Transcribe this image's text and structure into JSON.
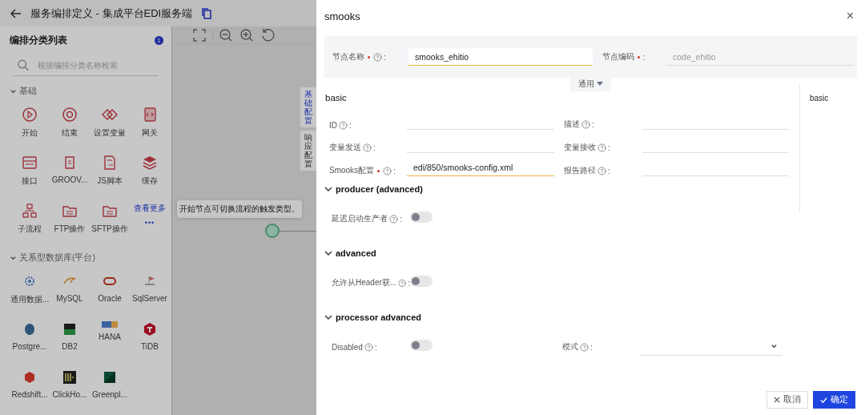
{
  "page": {
    "title": "服务编排定义 - 集成平台EDI服务端"
  },
  "palette": {
    "title": "编排分类列表",
    "badge": "1",
    "search_placeholder": "根据编排分类名称检索",
    "groups": [
      {
        "name": "基础",
        "expanded": true,
        "items": [
          {
            "label": "开始"
          },
          {
            "label": "结束"
          },
          {
            "label": "设置变量"
          },
          {
            "label": "网关"
          },
          {
            "label": "接口"
          },
          {
            "label": "GROOV..."
          },
          {
            "label": "JS脚本"
          },
          {
            "label": "缓存"
          },
          {
            "label": "子流程"
          },
          {
            "label": "FTP操作"
          },
          {
            "label": "SFTP操作"
          }
        ],
        "more": {
          "label": "查看更多",
          "dots": "•••"
        }
      },
      {
        "name": "关系型数据库(平台)",
        "expanded": true,
        "items": [
          {
            "label": "通用数据..."
          },
          {
            "label": "MySQL"
          },
          {
            "label": "Oracle"
          },
          {
            "label": "SqlServer"
          },
          {
            "label": "Postgre..."
          },
          {
            "label": "DB2"
          },
          {
            "label": "HANA"
          },
          {
            "label": "TiDB"
          },
          {
            "label": "Redshift..."
          },
          {
            "label": "ClickHo..."
          },
          {
            "label": "Greenpl..."
          }
        ]
      }
    ]
  },
  "canvas": {
    "side_tabs": [
      {
        "label": "基础配置",
        "selected": true
      },
      {
        "label": "响应配置",
        "selected": false
      }
    ],
    "tooltip": "开始节点可切换流程的触发类型。"
  },
  "drawer": {
    "title": "smooks",
    "close": "×",
    "header_fields": [
      {
        "label": "节点名称",
        "colon": ":",
        "required": true,
        "help": true,
        "value": "smooks_ehitio",
        "focused": true
      },
      {
        "label": "节点编码",
        "colon": ":",
        "required": true,
        "help": false,
        "placeholder": "code_ehitio",
        "focused": false
      }
    ],
    "collapse_toggle": "通用",
    "section_title": "basic",
    "nav": [
      {
        "label": "basic"
      }
    ],
    "basic_fields": [
      {
        "label": "ID",
        "colon": ":",
        "required": false,
        "help": true,
        "focused": false
      },
      {
        "label": "描述",
        "colon": ":",
        "required": false,
        "help": true,
        "focused": false
      },
      {
        "label": "变量发送",
        "colon": ":",
        "required": false,
        "help": true,
        "focused": false
      },
      {
        "label": "变量接收",
        "colon": ":",
        "required": false,
        "help": true,
        "focused": false
      },
      {
        "label": "Smooks配置",
        "colon": ":",
        "required": true,
        "help": true,
        "value": "edi/850/smooks-config.xml",
        "focused": true
      },
      {
        "label": "报告路径",
        "colon": ":",
        "required": false,
        "help": true,
        "focused": false
      }
    ],
    "sections": [
      {
        "title": "producer (advanced)",
        "expanded": true,
        "fields": [
          {
            "kind": "switch",
            "label": "延迟启动生产者",
            "colon": ":",
            "help": true,
            "on": false
          }
        ]
      },
      {
        "title": "advanced",
        "expanded": true,
        "fields": [
          {
            "kind": "switch",
            "label": "允许从Header获...",
            "colon": ":",
            "help": true,
            "on": false
          }
        ]
      },
      {
        "title": "processor advanced",
        "expanded": true,
        "fields": [
          {
            "kind": "switch",
            "label": "Disabled",
            "colon": ":",
            "help": true,
            "on": false
          },
          {
            "kind": "select",
            "label": "模式",
            "colon": ":",
            "help": true
          }
        ]
      }
    ],
    "buttons": [
      {
        "label": "取消",
        "kind": "cancel"
      },
      {
        "label": "确定",
        "kind": "ok"
      }
    ]
  }
}
